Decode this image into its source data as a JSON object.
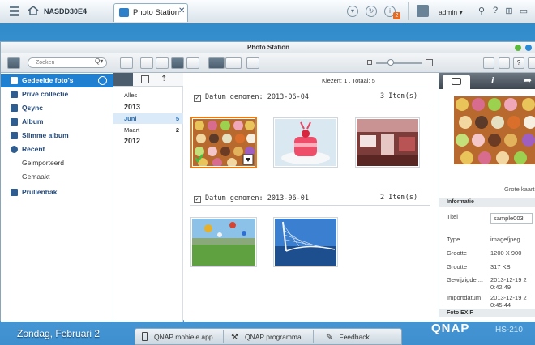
{
  "top": {
    "nas": "NASDD30E4",
    "tab_label": "Photo Station",
    "badge": "2",
    "user": "admin"
  },
  "window": {
    "title": "Photo Station"
  },
  "toolbar": {
    "search_placeholder": "Zoeken"
  },
  "sidebar": {
    "items": [
      {
        "label": "Gedeelde foto's",
        "icon": "shared-photos-icon",
        "active": true
      },
      {
        "label": "Privé collectie",
        "icon": "lock-icon"
      },
      {
        "label": "Qsync",
        "icon": "qsync-icon"
      },
      {
        "label": "Album",
        "icon": "album-icon"
      },
      {
        "label": "Slimme album",
        "icon": "smart-album-icon"
      },
      {
        "label": "Recent",
        "icon": "clock-icon"
      },
      {
        "label": "Geimporteerd",
        "sub": true
      },
      {
        "label": "Gemaakt",
        "sub": true
      },
      {
        "label": "Prullenbak",
        "icon": "trash-icon"
      }
    ]
  },
  "dates": {
    "all": "Alles",
    "y2013": "2013",
    "juni": "Juni",
    "juni_n": "5",
    "maart": "Maart",
    "maart_n": "2",
    "y2012": "2012"
  },
  "content": {
    "selection": "Kiezen: 1 , Totaal: 5",
    "group1": {
      "title": "Datum genomen: 2013-06-04",
      "count": "3 Item(s)"
    },
    "group2": {
      "title": "Datum genomen: 2013-06-01",
      "count": "2 Item(s)"
    }
  },
  "details": {
    "caption": "Grote kaart",
    "info_header": "Informatie",
    "title_label": "Titel",
    "title_value": "sample003",
    "type_label": "Type",
    "type_value": "image/jpeg",
    "size_label": "Grootte",
    "size_value": "1200 X 900",
    "filesize_label": "Grootte",
    "filesize_value": "317 KB",
    "modified_label": "Gewijzigde ...",
    "modified_value_1": "2013-12-19 2",
    "modified_value_2": "0:42:49",
    "import_label": "Importdatum",
    "import_value_1": "2013-12-19 2",
    "import_value_2": "0:45:44",
    "exif_header": "Foto EXIF"
  },
  "bottom": {
    "date": "Zondag, Februari 2",
    "mobile": "QNAP mobiele app",
    "program": "QNAP programma",
    "feedback": "Feedback",
    "brand": "QNAP",
    "model": "HS-210"
  }
}
